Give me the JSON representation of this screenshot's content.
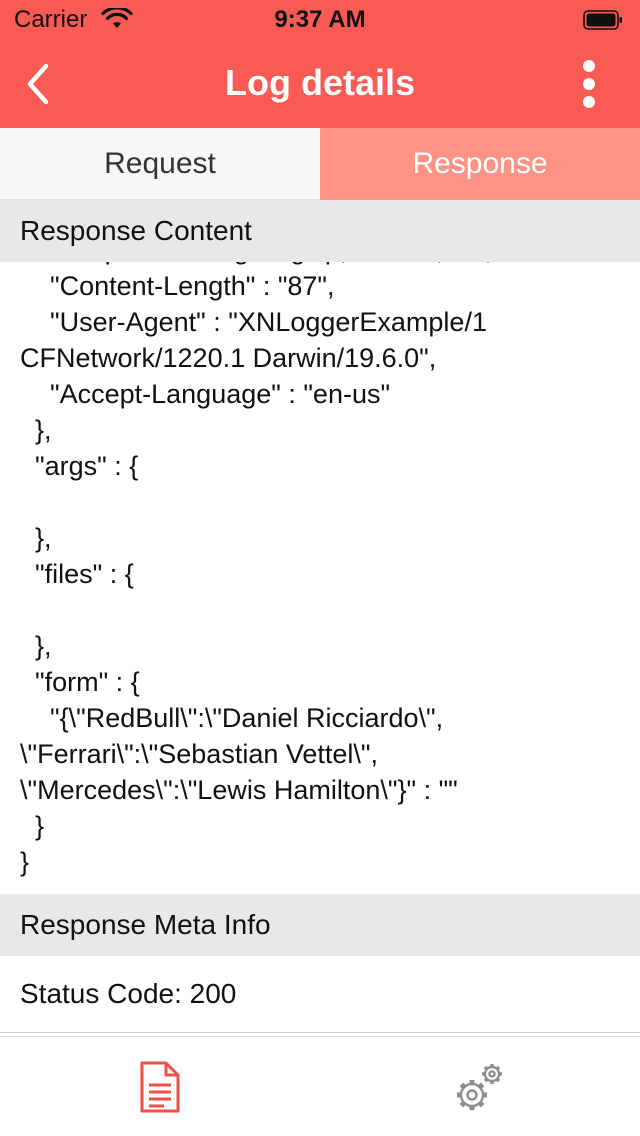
{
  "status_bar": {
    "carrier": "Carrier",
    "time": "9:37 AM"
  },
  "nav": {
    "title": "Log details"
  },
  "tabs": [
    {
      "label": "Request",
      "selected": false
    },
    {
      "label": "Response",
      "selected": true
    }
  ],
  "sections": {
    "response_content": "Response Content",
    "response_meta": "Response Meta Info"
  },
  "response_body": "  \"Accept-Encoding\" : \"gzip, deflate, br\",\n    \"Content-Length\" : \"87\",\n    \"User-Agent\" : \"XNLoggerExample/1\nCFNetwork/1220.1 Darwin/19.6.0\",\n    \"Accept-Language\" : \"en-us\"\n  },\n  \"args\" : {\n\n  },\n  \"files\" : {\n\n  },\n  \"form\" : {\n    \"{\\\"RedBull\\\":\\\"Daniel Ricciardo\\\",\n\\\"Ferrari\\\":\\\"Sebastian Vettel\\\",\n\\\"Mercedes\\\":\\\"Lewis Hamilton\\\"}\" : \"\"\n  }\n}",
  "meta": {
    "status_code": "Status Code: 200"
  },
  "tab_bar": {
    "items": [
      "log-icon",
      "settings-icon"
    ]
  },
  "colors": {
    "accent": "#f95a53",
    "selected_tab": "#fd9386",
    "section_bg": "#e8e8e8"
  }
}
